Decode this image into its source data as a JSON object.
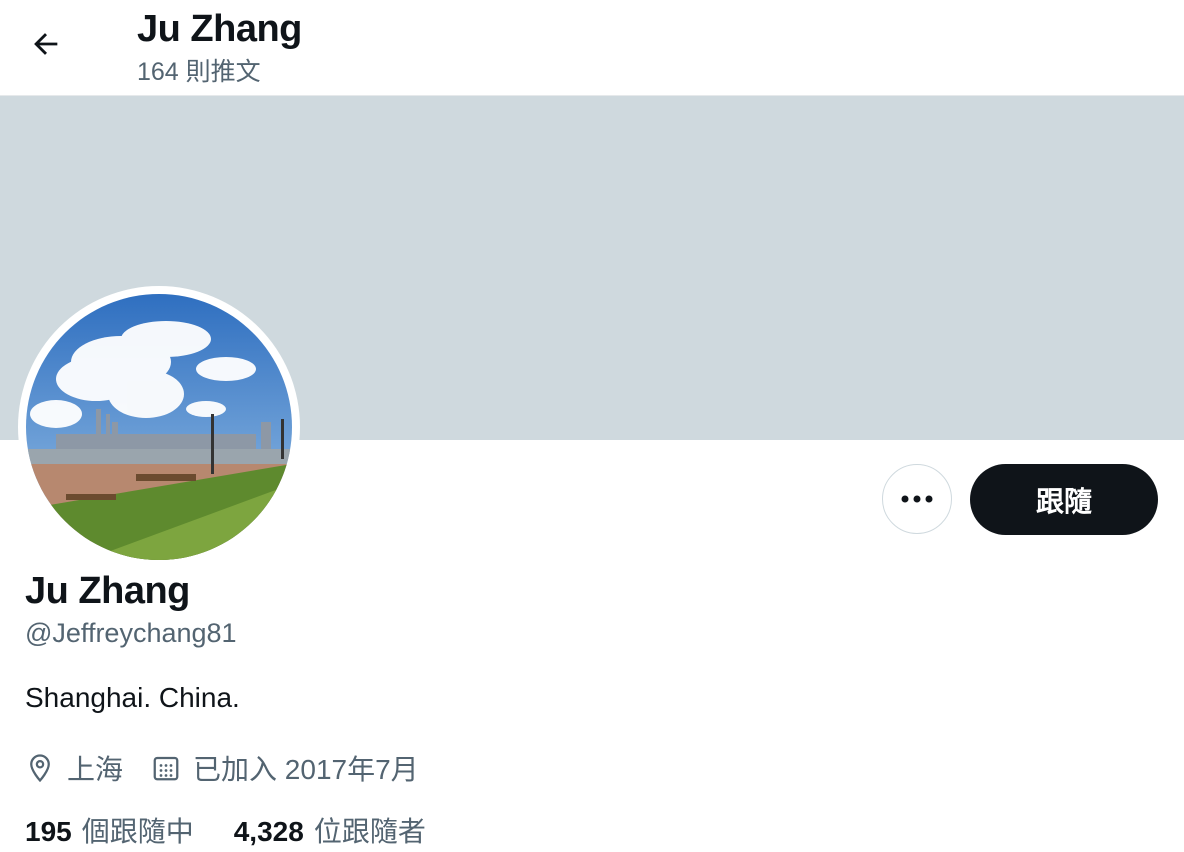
{
  "header": {
    "back_icon": "arrow-left-icon",
    "title": "Ju Zhang",
    "tweet_count": "164 則推文"
  },
  "profile": {
    "name": "Ju Zhang",
    "handle": "@Jeffreychang81",
    "bio": "Shanghai. China.",
    "location": "上海",
    "joined": "已加入 2017年7月",
    "following_count": "195",
    "following_label": "個跟隨中",
    "followers_count": "4,328",
    "followers_label": "位跟隨者"
  },
  "actions": {
    "more_icon": "more-dots-icon",
    "follow_label": "跟隨"
  },
  "colors": {
    "banner": "#cfd9de",
    "primary_text": "#0f1419",
    "secondary_text": "#536471",
    "button_dark": "#0f1419"
  }
}
